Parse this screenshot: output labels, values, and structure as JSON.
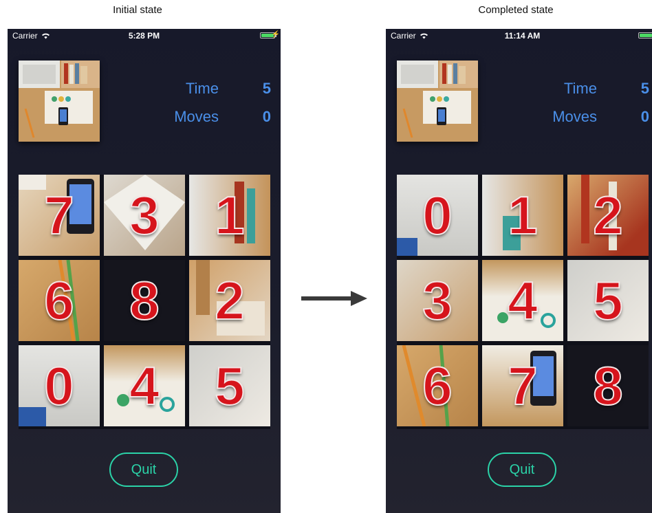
{
  "captions": {
    "initial": "Initial state",
    "completed": "Completed state"
  },
  "left": {
    "carrier": "Carrier",
    "clock": "5:28 PM",
    "time_label": "Time",
    "time_value": "5",
    "moves_label": "Moves",
    "moves_value": "0",
    "quit_label": "Quit",
    "tiles": [
      "7",
      "3",
      "1",
      "6",
      "8",
      "2",
      "0",
      "4",
      "5"
    ],
    "empty_tile": "8"
  },
  "right": {
    "carrier": "Carrier",
    "clock": "11:14 AM",
    "time_label": "Time",
    "time_value": "5",
    "moves_label": "Moves",
    "moves_value": "0",
    "quit_label": "Quit",
    "tiles": [
      "0",
      "1",
      "2",
      "3",
      "4",
      "5",
      "6",
      "7",
      "8"
    ],
    "empty_tile": "8"
  },
  "colors": {
    "accent_blue": "#4a8fe8",
    "quit_green": "#2bd3a8",
    "tile_number": "#d6141c",
    "battery": "#4cd964"
  },
  "icons": {
    "wifi": "wifi-icon",
    "battery": "battery-icon",
    "arrow": "right-arrow-icon"
  }
}
